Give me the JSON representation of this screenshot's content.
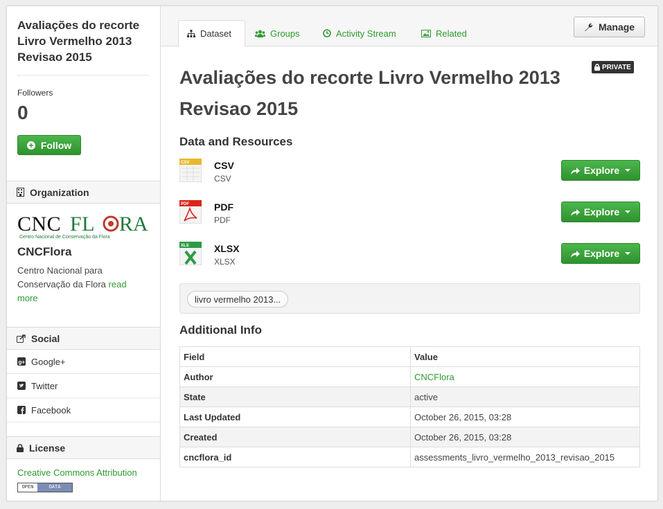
{
  "sidebar": {
    "title": "Avaliações do recorte Livro Vermelho 2013 Revisao 2015",
    "followers_label": "Followers",
    "followers_count": "0",
    "follow_label": "Follow",
    "organization_heading": "Organization",
    "org_logo_text": "CNCFLORA",
    "org_logo_subtitle": "Centro Nacional de Conservação da Flora",
    "org_name": "CNCFlora",
    "org_desc": "Centro Nacional para Conservação da Flora",
    "read_more": "read more",
    "social_heading": "Social",
    "social": [
      "Google+",
      "Twitter",
      "Facebook"
    ],
    "license_heading": "License",
    "license_link": "Creative Commons Attribution",
    "opendata_left": "OPEN",
    "opendata_right": "DATA"
  },
  "tabs": [
    {
      "label": "Dataset",
      "icon": "sitemap-icon"
    },
    {
      "label": "Groups",
      "icon": "users-icon"
    },
    {
      "label": "Activity Stream",
      "icon": "clock-icon"
    },
    {
      "label": "Related",
      "icon": "picture-icon"
    }
  ],
  "manage_label": "Manage",
  "dataset": {
    "title": "Avaliações do recorte Livro Vermelho 2013 Revisao 2015",
    "private_label": "PRIVATE",
    "resources_heading": "Data and Resources",
    "resources": [
      {
        "name": "CSV",
        "format": "CSV",
        "icon_label": "CSV",
        "color": "#e8b82c"
      },
      {
        "name": "PDF",
        "format": "PDF",
        "icon_label": "PDF",
        "color": "#d9261c"
      },
      {
        "name": "XLSX",
        "format": "XLSX",
        "icon_label": "XLS",
        "color": "#2e9b45"
      }
    ],
    "explore_label": "Explore",
    "tag": "livro vermelho 2013...",
    "additional_heading": "Additional Info",
    "table_headers": [
      "Field",
      "Value"
    ],
    "rows": [
      {
        "field": "Author",
        "value": "CNCFlora",
        "link": true
      },
      {
        "field": "State",
        "value": "active"
      },
      {
        "field": "Last Updated",
        "value": "October 26, 2015, 03:28"
      },
      {
        "field": "Created",
        "value": "October 26, 2015, 03:28"
      },
      {
        "field": "cncflora_id",
        "value": "assessments_livro_vermelho_2013_revisao_2015"
      }
    ]
  },
  "colors": {
    "accent": "#2f9a2f",
    "button_green": "#3aa83a",
    "private_bg": "#333333"
  }
}
